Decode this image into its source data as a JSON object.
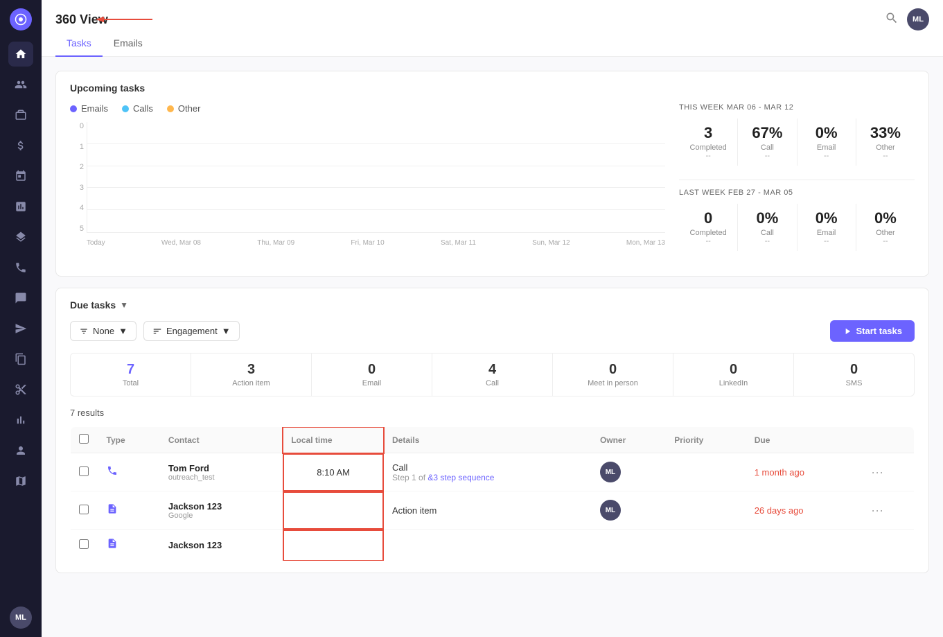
{
  "app": {
    "title": "360 View",
    "logo": "○",
    "user_initials": "ML"
  },
  "tabs": [
    {
      "label": "Tasks",
      "active": true
    },
    {
      "label": "Emails",
      "active": false
    }
  ],
  "sidebar": {
    "icons": [
      "home",
      "people",
      "briefcase",
      "dollar",
      "calendar",
      "chart",
      "layers",
      "phone",
      "chat",
      "send",
      "copy",
      "scissors",
      "bar-chart",
      "person",
      "map"
    ]
  },
  "upcoming_tasks": {
    "title": "Upcoming tasks",
    "legend": [
      {
        "label": "Emails",
        "color": "#6c63ff"
      },
      {
        "label": "Calls",
        "color": "#4fc3f7"
      },
      {
        "label": "Other",
        "color": "#ffb74d"
      }
    ],
    "chart": {
      "y_labels": [
        "5",
        "4",
        "3",
        "2",
        "1",
        "0"
      ],
      "x_labels": [
        "Today",
        "Wed, Mar 08",
        "Thu, Mar 09",
        "Fri, Mar 10",
        "Sat, Mar 11",
        "Sun, Mar 12",
        "Mon, Mar 13"
      ]
    },
    "this_week": {
      "title": "THIS WEEK",
      "date_range": "MAR 06 - MAR 12",
      "stats": [
        {
          "value": "3",
          "label": "Completed",
          "sub": "--"
        },
        {
          "value": "67%",
          "label": "Call",
          "sub": "--"
        },
        {
          "value": "0%",
          "label": "Email",
          "sub": "--"
        },
        {
          "value": "33%",
          "label": "Other",
          "sub": "--"
        }
      ]
    },
    "last_week": {
      "title": "LAST WEEK",
      "date_range": "FEB 27 - MAR 05",
      "stats": [
        {
          "value": "0",
          "label": "Completed",
          "sub": "--"
        },
        {
          "value": "0%",
          "label": "Call",
          "sub": "--"
        },
        {
          "value": "0%",
          "label": "Email",
          "sub": "--"
        },
        {
          "value": "0%",
          "label": "Other",
          "sub": "--"
        }
      ]
    }
  },
  "due_tasks": {
    "title": "Due tasks",
    "filter_none": "None",
    "filter_engagement": "Engagement",
    "start_tasks_label": "Start tasks",
    "counts": [
      {
        "value": "7",
        "label": "Total",
        "highlight": true
      },
      {
        "value": "3",
        "label": "Action item",
        "highlight": false
      },
      {
        "value": "0",
        "label": "Email",
        "highlight": false
      },
      {
        "value": "4",
        "label": "Call",
        "highlight": false
      },
      {
        "value": "0",
        "label": "Meet in person",
        "highlight": false
      },
      {
        "value": "0",
        "label": "LinkedIn",
        "highlight": false
      },
      {
        "value": "0",
        "label": "SMS",
        "highlight": false
      }
    ],
    "results_count": "7 results",
    "table": {
      "headers": [
        "",
        "Type",
        "Contact",
        "Local time",
        "Details",
        "Owner",
        "Priority",
        "Due",
        ""
      ],
      "rows": [
        {
          "checked": false,
          "type_icon": "phone",
          "contact_name": "Tom Ford",
          "contact_sub": "outreach_test",
          "local_time": "8:10 AM",
          "details_type": "Call",
          "details_sub": "Step 1 of &3 step sequence",
          "details_link": "&3 step sequence",
          "owner_initials": "ML",
          "priority": "",
          "due": "1 month ago"
        },
        {
          "checked": false,
          "type_icon": "doc",
          "contact_name": "Jackson 123",
          "contact_sub": "Google",
          "local_time": "",
          "details_type": "Action item",
          "details_sub": "",
          "details_link": "",
          "owner_initials": "ML",
          "priority": "",
          "due": "26 days ago"
        },
        {
          "checked": false,
          "type_icon": "doc",
          "contact_name": "Jackson 123",
          "contact_sub": "",
          "local_time": "",
          "details_type": "",
          "details_sub": "",
          "details_link": "",
          "owner_initials": "",
          "priority": "",
          "due": ""
        }
      ]
    }
  }
}
